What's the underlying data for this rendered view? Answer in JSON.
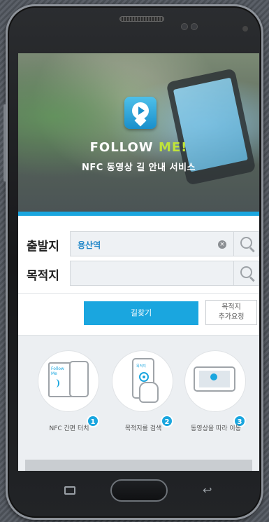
{
  "hero": {
    "brand_follow": "FOLLOW",
    "brand_me": "ME!",
    "tagline": "NFC 동영상 길 안내 서비스",
    "icon": "video-pin-icon"
  },
  "form": {
    "departure_label": "출발지",
    "departure_value": "용산역",
    "destination_label": "목적지",
    "destination_value": "",
    "clear_icon": "clear-icon",
    "search_icon": "search-icon"
  },
  "buttons": {
    "find_route": "길찾기",
    "add_destination_line1": "목적지",
    "add_destination_line2": "추가요청"
  },
  "steps": [
    {
      "number": "1",
      "label": "NFC 간편 터치",
      "card_text": "Follow Me"
    },
    {
      "number": "2",
      "label": "목적지를 검색",
      "screen_text": "목적지"
    },
    {
      "number": "3",
      "label": "동영상을 따라 이동"
    }
  ],
  "colors": {
    "accent": "#1aa6df",
    "brand_green": "#bfe33a"
  }
}
